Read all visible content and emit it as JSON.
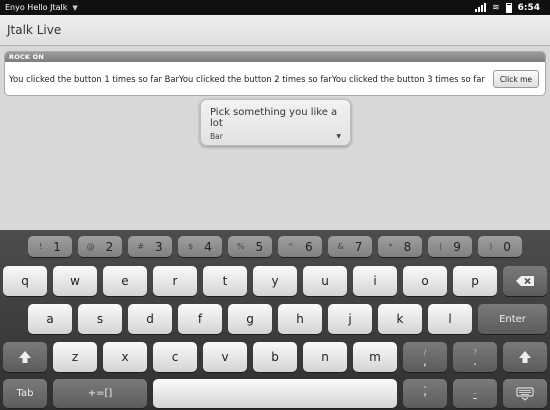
{
  "status_bar": {
    "app_name": "Enyo Hello Jtalk",
    "menu_caret": "▼",
    "time": "6:54"
  },
  "header": {
    "title": "Jtalk Live"
  },
  "group": {
    "title": "ROCK ON",
    "message": "You clicked the button 1 times so far BarYou clicked the button 2 times so farYou clicked the button 3 times so far",
    "button_label": "Click me"
  },
  "picker": {
    "title": "Pick something you like a lot",
    "selected": "Bar",
    "arrow": "▼"
  },
  "keyboard": {
    "number_row": [
      {
        "alt": "!",
        "main": "1"
      },
      {
        "alt": "@",
        "main": "2"
      },
      {
        "alt": "#",
        "main": "3"
      },
      {
        "alt": "$",
        "main": "4"
      },
      {
        "alt": "%",
        "main": "5"
      },
      {
        "alt": "^",
        "main": "6"
      },
      {
        "alt": "&",
        "main": "7"
      },
      {
        "alt": "*",
        "main": "8"
      },
      {
        "alt": "(",
        "main": "9"
      },
      {
        "alt": ")",
        "main": "0"
      }
    ],
    "row1": [
      "q",
      "w",
      "e",
      "r",
      "t",
      "y",
      "u",
      "i",
      "o",
      "p"
    ],
    "row2": [
      "a",
      "s",
      "d",
      "f",
      "g",
      "h",
      "j",
      "k",
      "l"
    ],
    "row3": [
      "z",
      "x",
      "c",
      "v",
      "b",
      "n",
      "m"
    ],
    "comma_key": {
      "alt": "/",
      "main": ","
    },
    "period_key": {
      "alt": "?",
      "main": "."
    },
    "quote_key": {
      "alt": "\"",
      "main": "'"
    },
    "dash_key": {
      "alt": "_",
      "main": "-"
    },
    "enter_label": "Enter",
    "tab_label": "Tab",
    "symbols_label": "+=[]",
    "backspace_icon": "backspace-icon",
    "shift_icon": "shift-arrow-icon",
    "hide_keyboard_icon": "keyboard-icon"
  }
}
